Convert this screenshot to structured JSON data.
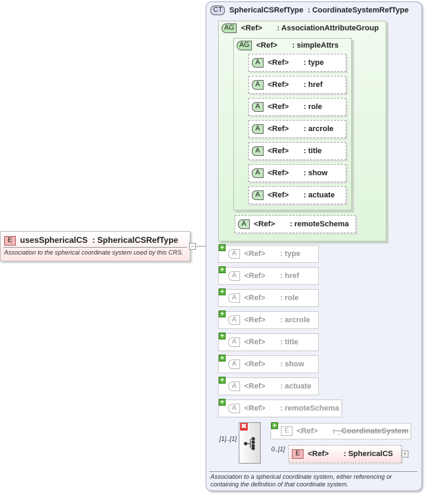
{
  "element": {
    "badge": "E",
    "name": "usesSphericalCS",
    "type": ": SphericalCSRefType",
    "description": "Association to the spherical coordinate system used by this CRS."
  },
  "complex_type": {
    "badge": "CT",
    "name": "SphericalCSRefType",
    "base": ": CoordinateSystemRefType",
    "description": "Association to a spherical coordinate system, either referencing or containing the definition of that coordinate system."
  },
  "association_group": {
    "badge": "AG",
    "ref": "<Ref>",
    "name": ": AssociationAttributeGroup"
  },
  "simple_attrs": {
    "badge": "AG",
    "ref": "<Ref>",
    "name": ": simpleAttrs",
    "attributes": [
      {
        "badge": "A",
        "ref": "<Ref>",
        "name": ": type"
      },
      {
        "badge": "A",
        "ref": "<Ref>",
        "name": ": href"
      },
      {
        "badge": "A",
        "ref": "<Ref>",
        "name": ": role"
      },
      {
        "badge": "A",
        "ref": "<Ref>",
        "name": ": arcrole"
      },
      {
        "badge": "A",
        "ref": "<Ref>",
        "name": ": title"
      },
      {
        "badge": "A",
        "ref": "<Ref>",
        "name": ": show"
      },
      {
        "badge": "A",
        "ref": "<Ref>",
        "name": ": actuate"
      }
    ]
  },
  "remote_schema": {
    "badge": "A",
    "ref": "<Ref>",
    "name": ": remoteSchema"
  },
  "inherited_attributes": [
    {
      "badge": "A",
      "ref": "<Ref>",
      "name": ": type"
    },
    {
      "badge": "A",
      "ref": "<Ref>",
      "name": ": href"
    },
    {
      "badge": "A",
      "ref": "<Ref>",
      "name": ": role"
    },
    {
      "badge": "A",
      "ref": "<Ref>",
      "name": ": arcrole"
    },
    {
      "badge": "A",
      "ref": "<Ref>",
      "name": ": title"
    },
    {
      "badge": "A",
      "ref": "<Ref>",
      "name": ": show"
    },
    {
      "badge": "A",
      "ref": "<Ref>",
      "name": ": actuate"
    },
    {
      "badge": "A",
      "ref": "<Ref>",
      "name": ": remoteSchema"
    }
  ],
  "choice": {
    "cardinality": "[1]..[1]",
    "options": [
      {
        "badge": "E",
        "ref": "<Ref>",
        "name": ": _CoordinateSystem",
        "state": "removed"
      },
      {
        "badge": "E",
        "ref": "<Ref>",
        "name": ": SphericalCS",
        "cardinality": "0..[1]"
      }
    ]
  },
  "colors": {
    "element": "#f3b7b7",
    "attribute_group": "#dff5db",
    "complex_type": "#eef0fa"
  }
}
